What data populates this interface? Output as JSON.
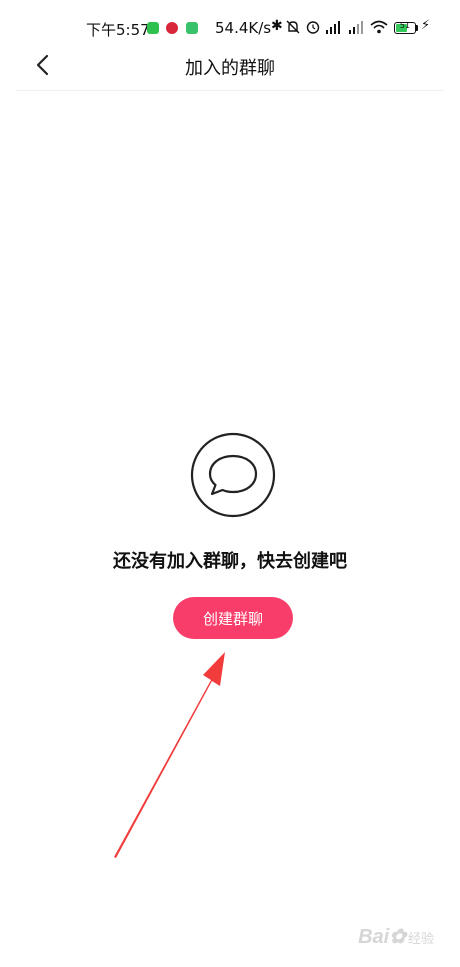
{
  "status_bar": {
    "time": "下午5:57",
    "net_speed": "54.4K/s",
    "battery_level": "51",
    "icons": [
      "wechat-icon",
      "app-icon",
      "app-icon",
      "bluetooth-icon",
      "mute-icon",
      "alarm-icon",
      "signal-hd-icon",
      "signal-hd-icon",
      "wifi-icon",
      "battery-icon",
      "charging-icon"
    ]
  },
  "nav": {
    "title": "加入的群聊"
  },
  "empty_state": {
    "message": "还没有加入群聊，快去创建吧",
    "button_label": "创建群聊"
  },
  "colors": {
    "accent": "#f83d6a",
    "arrow": "#f23b3b"
  },
  "watermark": {
    "text": "Bai",
    "suffix": "经验"
  }
}
